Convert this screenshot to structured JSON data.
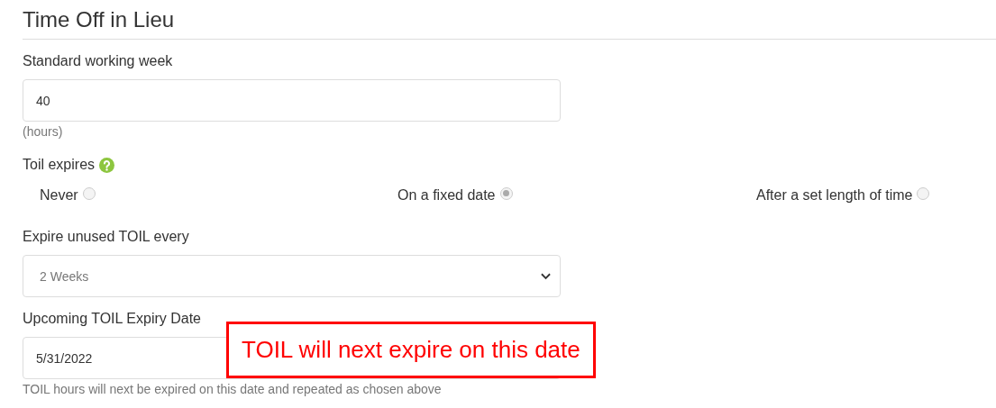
{
  "title": "Time Off in Lieu",
  "working_week": {
    "label": "Standard working week",
    "value": "40",
    "unit": "(hours)"
  },
  "toil_expires": {
    "label": "Toil expires",
    "options": [
      {
        "label": "Never",
        "selected": false
      },
      {
        "label": "On a fixed date",
        "selected": true
      },
      {
        "label": "After a set length of time",
        "selected": false
      }
    ]
  },
  "expire_every": {
    "label": "Expire unused TOIL every",
    "value": "2 Weeks"
  },
  "expiry_date": {
    "label": "Upcoming TOIL Expiry Date",
    "value": "5/31/2022",
    "help": "TOIL hours will next be expired on this date and repeated as chosen above"
  },
  "callout": "TOIL will next expire on this date"
}
